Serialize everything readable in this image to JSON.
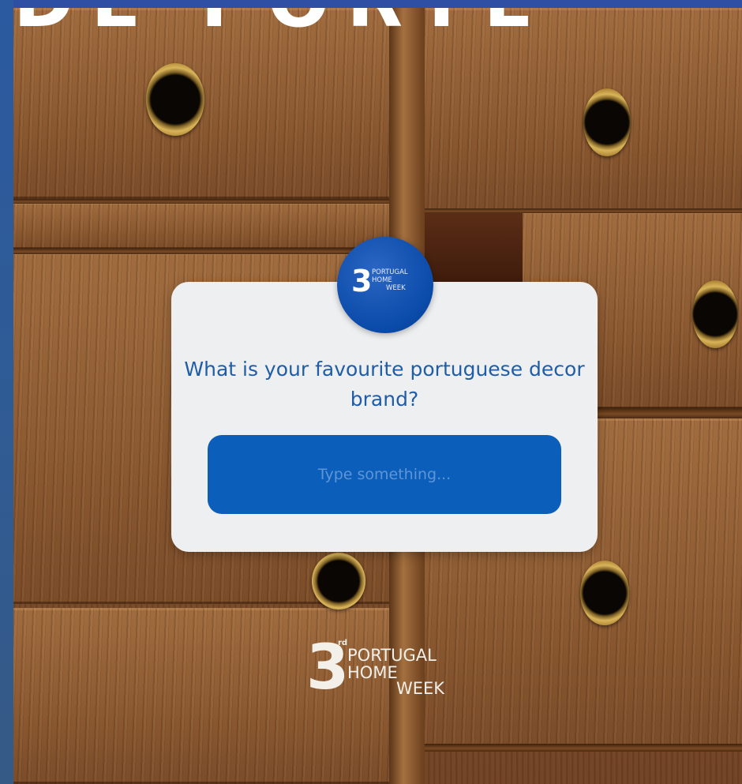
{
  "banner": {
    "text": "DE FORTE"
  },
  "badge": {
    "number": "3",
    "line1": "PORTUGAL",
    "line2": "HOME",
    "line3": "WEEK"
  },
  "question": {
    "text": "What is your favourite portuguese decor brand?"
  },
  "answer": {
    "placeholder": "Type something..."
  },
  "footer_logo": {
    "number": "3",
    "ordinal": "rd",
    "line1": "PORTUGAL",
    "line2": "HOME",
    "line3": "WEEK"
  },
  "colors": {
    "brand_blue": "#0b5fba",
    "frame_blue": "#2e4fa3",
    "card_bg": "#eeeff1",
    "question_text": "#1f5da6"
  }
}
